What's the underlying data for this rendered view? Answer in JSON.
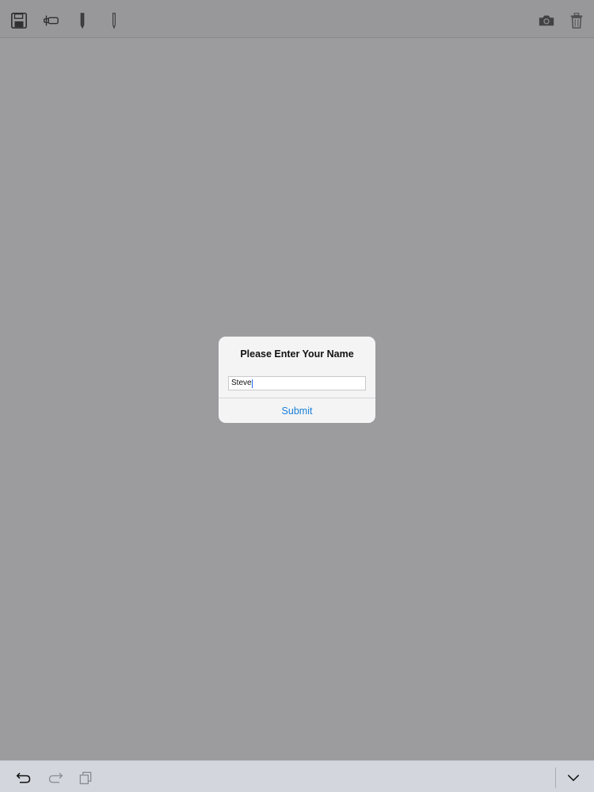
{
  "toolbar": {
    "left_icons": [
      "save-icon",
      "eraser-icon",
      "pencil-icon",
      "thin-pencil-icon"
    ],
    "right_icons": [
      "camera-icon",
      "trash-icon"
    ]
  },
  "alert": {
    "title": "Please Enter Your Name",
    "input_value": "Steve",
    "action_label": "Submit"
  },
  "keyboard_bar": {
    "icons": [
      "undo-icon",
      "redo-icon",
      "paste-icon",
      "dismiss-keyboard-icon"
    ]
  },
  "colors": {
    "accent": "#1a7fd6",
    "overlay": "#9b999e",
    "keyboard_bar": "#d3d6dc"
  }
}
